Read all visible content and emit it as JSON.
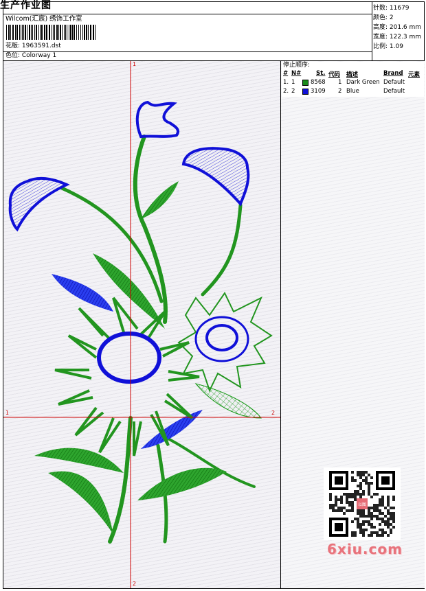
{
  "header": {
    "title": "生产作业图",
    "subtitle": "Wilcom(汇宸) 绣饰工作室",
    "design_label": "花版: 1963591.dst",
    "colorway_label": "色位: Colorway 1"
  },
  "stats": {
    "stitches": "针数: 11679",
    "colors": "颜色: 2",
    "height": "高度: 201.6 mm",
    "width": "宽度: 122.3 mm",
    "scale": "比例: 1.09"
  },
  "stop_sequence": {
    "title": "停止顺序:",
    "headers": [
      "#",
      "N#",
      "St.",
      "代码",
      "描述",
      "Brand",
      "元素"
    ],
    "rows": [
      {
        "idx": "1.",
        "n": "1",
        "stitches": "8568",
        "code": "1",
        "description": "Dark Green",
        "brand": "Default",
        "color": "#1a8a1a"
      },
      {
        "idx": "2.",
        "n": "2",
        "stitches": "3109",
        "code": "2",
        "description": "Blue",
        "brand": "Default",
        "color": "#1010d8"
      }
    ]
  },
  "axes": {
    "v_top": "1",
    "v_bottom": "2",
    "h_left": "1",
    "h_right": "2",
    "color": "#cc0000"
  },
  "watermark": "6xiu.com",
  "qr_stamp": "以图"
}
